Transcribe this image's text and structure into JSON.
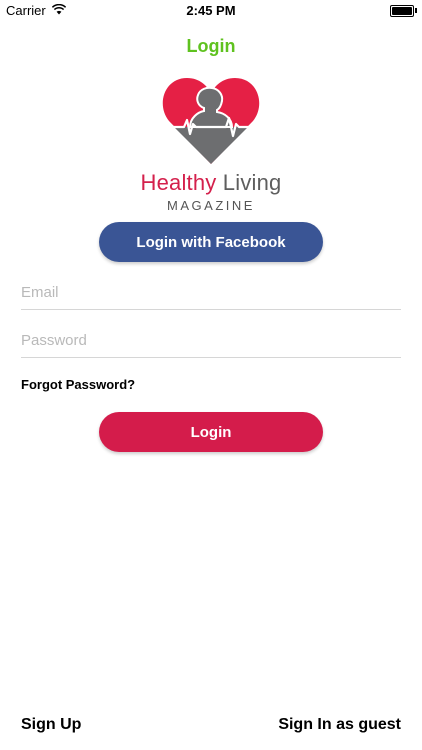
{
  "status_bar": {
    "carrier": "Carrier",
    "time": "2:45 PM"
  },
  "nav": {
    "title": "Login"
  },
  "brand": {
    "name_primary": "Healthy",
    "name_secondary": " Living",
    "subtitle": "MAGAZINE"
  },
  "facebook_button": {
    "label": "Login with Facebook"
  },
  "form": {
    "email_placeholder": "Email",
    "password_placeholder": "Password",
    "forgot_label": "Forgot Password?",
    "login_label": "Login"
  },
  "footer": {
    "sign_up": "Sign Up",
    "guest": "Sign In as guest"
  },
  "colors": {
    "accent_green": "#5fc21f",
    "brand_red": "#d41c4b",
    "facebook_blue": "#3a5595"
  },
  "icons": [
    "wifi-icon",
    "battery-icon",
    "heart-logo-icon"
  ]
}
